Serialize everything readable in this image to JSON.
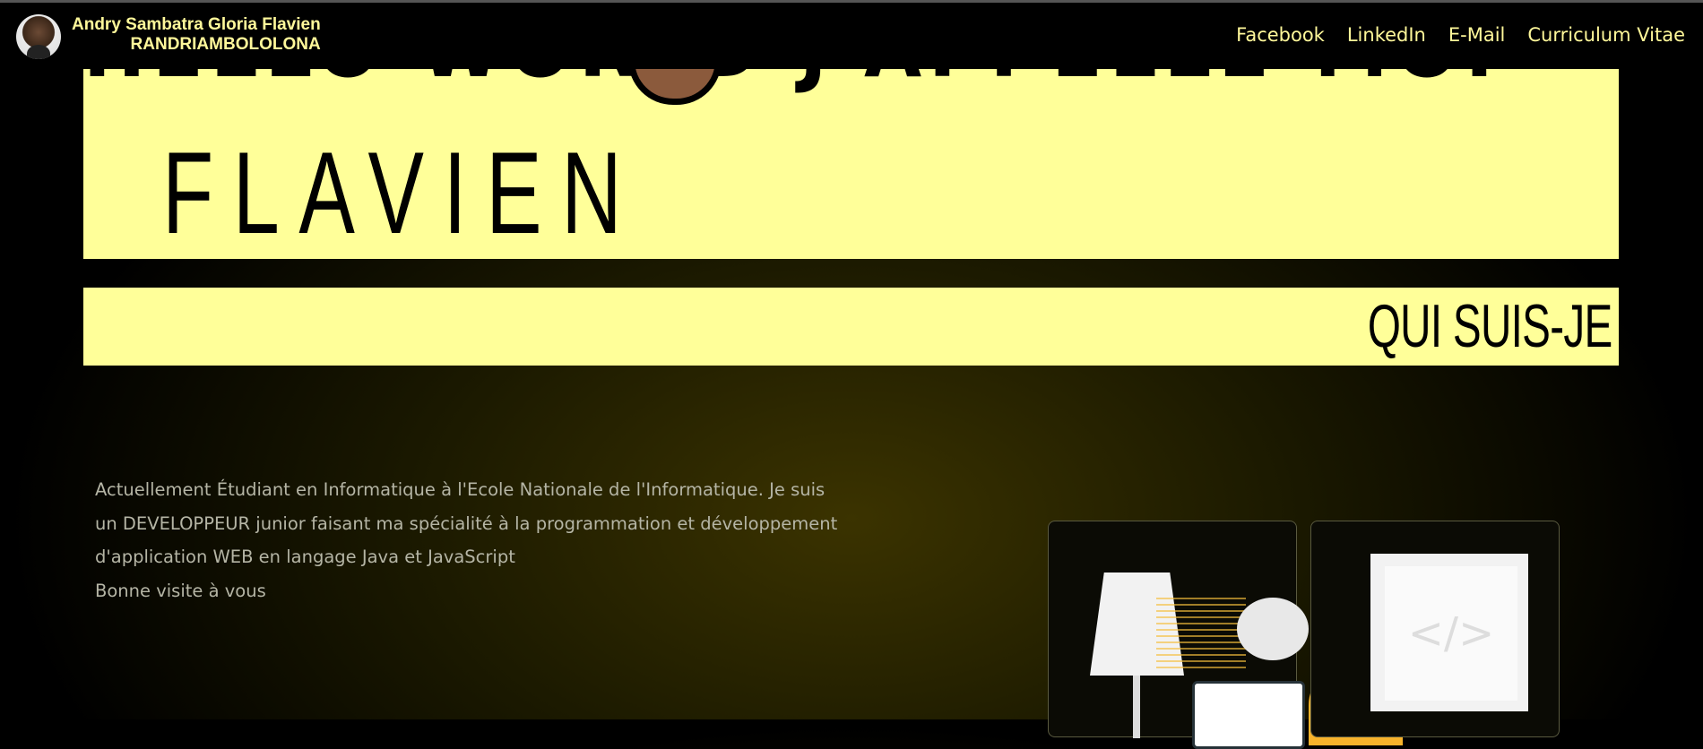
{
  "header": {
    "name_line1": "Andry Sambatra Gloria Flavien",
    "name_line2": "RANDRIAMBOLOLONA",
    "nav": [
      "Facebook",
      "LinkedIn",
      "E-Mail",
      "Curriculum Vitae"
    ]
  },
  "hero": {
    "greeting_partial": "HELLO WORLD    J'APPELLE-MOI",
    "name": "FLAVIEN"
  },
  "about": {
    "title": "QUI SUIS-JE",
    "line1": "Actuellement Étudiant en Informatique à l'Ecole Nationale de l'Informatique. Je suis",
    "line2": "un DEVELOPPEUR junior faisant ma spécialité à la programmation et développement",
    "line3": "d'application WEB en langage Java et JavaScript",
    "line4": "Bonne visite à vous"
  },
  "cards": {
    "code_symbol": "</>"
  },
  "colors": {
    "accent": "#ffff99",
    "nav_text": "#fff89a",
    "background": "#000000"
  }
}
